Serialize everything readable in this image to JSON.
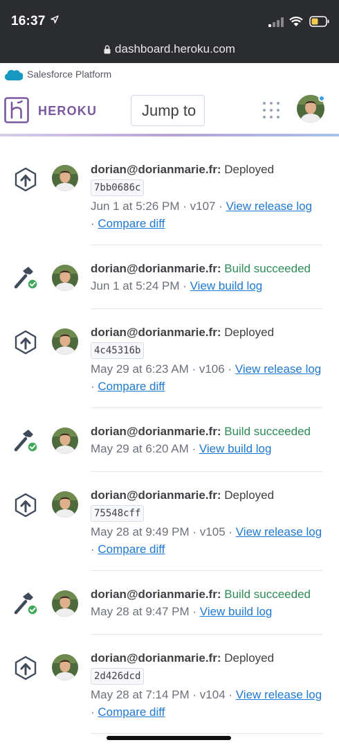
{
  "status_bar": {
    "time": "16:37"
  },
  "browser": {
    "url": "dashboard.heroku.com"
  },
  "salesforce": {
    "label": "Salesforce Platform"
  },
  "header": {
    "brand": "HEROKU",
    "search_placeholder": "Jump to"
  },
  "feed": [
    {
      "type": "deploy",
      "user": "dorian@dorianmarie.fr:",
      "action": "Deployed",
      "commit": "7bb0686c",
      "meta": "Jun 1 at 5:26 PM · v107 · ",
      "link1": "View release log",
      "sep": "· ",
      "link2": "Compare diff"
    },
    {
      "type": "build",
      "user": "dorian@dorianmarie.fr:",
      "action": "Build succeeded",
      "meta": "Jun 1 at 5:24 PM · ",
      "link1": "View build log"
    },
    {
      "type": "deploy",
      "user": "dorian@dorianmarie.fr:",
      "action": "Deployed",
      "commit": "4c45316b",
      "meta": "May 29 at 6:23 AM · v106 · ",
      "link1": "View release log",
      "sep": " · ",
      "link2": "Compare diff"
    },
    {
      "type": "build",
      "user": "dorian@dorianmarie.fr:",
      "action": "Build succeeded",
      "meta": "May 29 at 6:20 AM · ",
      "link1": "View build log"
    },
    {
      "type": "deploy",
      "user": "dorian@dorianmarie.fr:",
      "action": "Deployed",
      "commit": "75548cff",
      "meta": "May 28 at 9:49 PM · v105 · ",
      "link1": "View release log",
      "sep": " · ",
      "link2": "Compare diff"
    },
    {
      "type": "build",
      "user": "dorian@dorianmarie.fr:",
      "action": "Build succeeded",
      "meta": "May 28 at 9:47 PM · ",
      "link1": "View build log"
    },
    {
      "type": "deploy",
      "user": "dorian@dorianmarie.fr:",
      "action": "Deployed",
      "commit": "2d426dcd",
      "meta": "May 28 at 7:14 PM · v104 · ",
      "link1": "View release log",
      "sep": " · ",
      "link2": "Compare diff"
    }
  ]
}
